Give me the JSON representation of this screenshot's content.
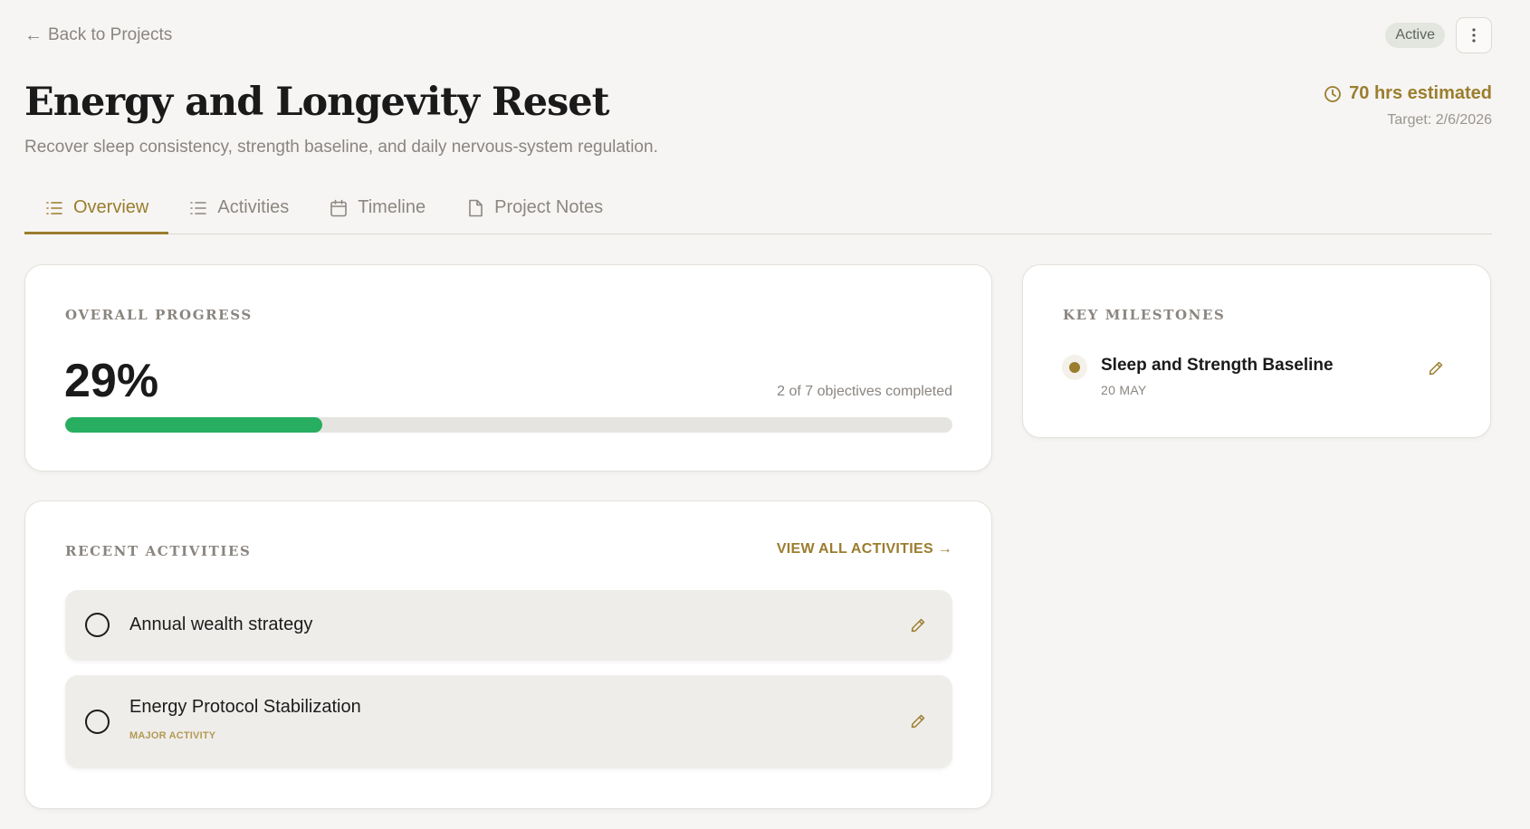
{
  "topbar": {
    "back_label": "Back to Projects",
    "status": "Active"
  },
  "project": {
    "title": "Energy and Longevity Reset",
    "description": "Recover sleep consistency, strength baseline, and daily nervous-system regulation.",
    "estimate": "70 hrs estimated",
    "target": "Target: 2/6/2026"
  },
  "tabs": [
    {
      "label": "Overview",
      "icon": "list-icon",
      "active": true
    },
    {
      "label": "Activities",
      "icon": "list-icon",
      "active": false
    },
    {
      "label": "Timeline",
      "icon": "calendar-icon",
      "active": false
    },
    {
      "label": "Project Notes",
      "icon": "document-icon",
      "active": false
    }
  ],
  "progress": {
    "label": "OVERALL PROGRESS",
    "percent_text": "29%",
    "percent": 29,
    "objectives": "2 of 7 objectives completed"
  },
  "activities": {
    "label": "RECENT ACTIVITIES",
    "view_all": "VIEW ALL ACTIVITIES",
    "items": [
      {
        "title": "Annual wealth strategy",
        "tag": "",
        "done": false
      },
      {
        "title": "Energy Protocol Stabilization",
        "tag": "MAJOR ACTIVITY",
        "done": false
      }
    ]
  },
  "milestones": {
    "label": "KEY MILESTONES",
    "items": [
      {
        "title": "Sleep and Strength Baseline",
        "date": "20 MAY"
      }
    ]
  },
  "colors": {
    "accent": "#9b7d2e",
    "progress_fill": "#27ae60",
    "background": "#f6f5f3"
  }
}
